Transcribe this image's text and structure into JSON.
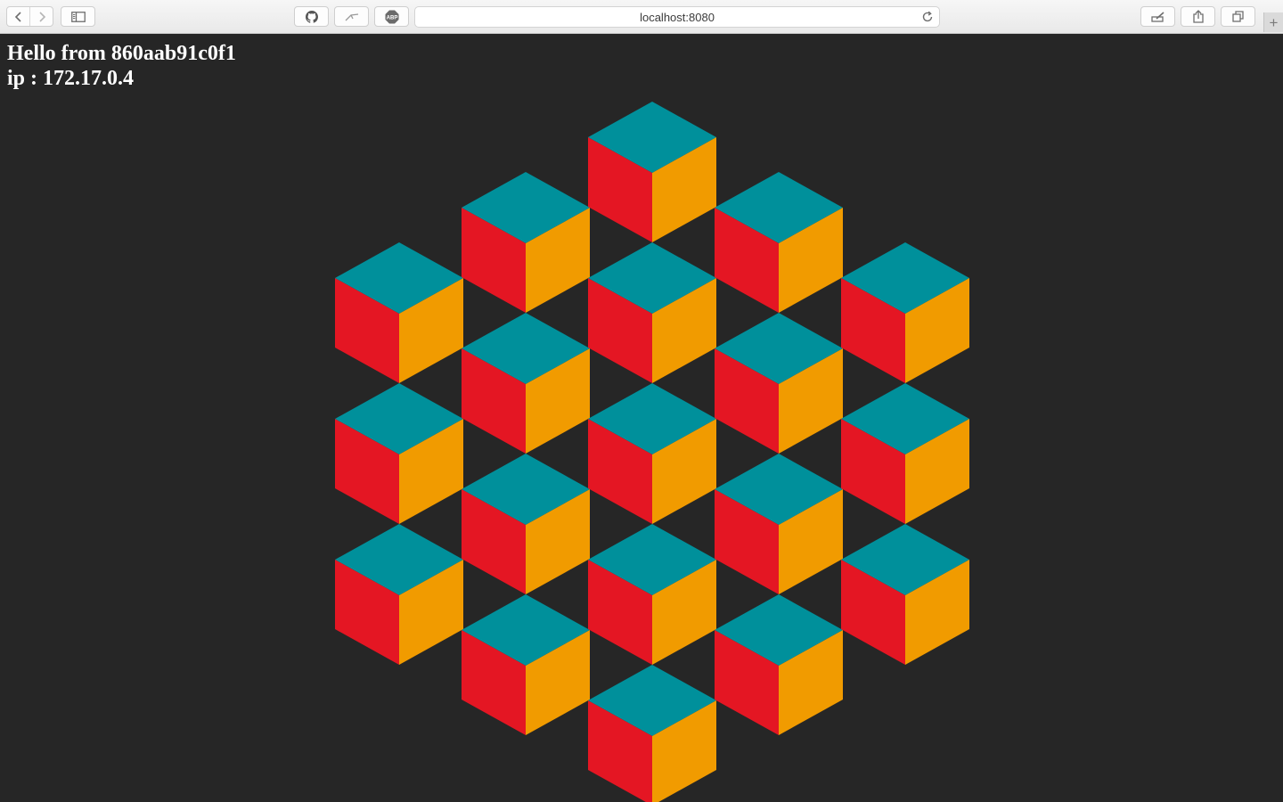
{
  "browser": {
    "url": "localhost:8080",
    "icons": {
      "back": "back-arrow-icon",
      "forward": "forward-arrow-icon",
      "sidebar": "sidebar-icon",
      "github": "github-icon",
      "extension": "extension-icon",
      "adblock": "adblock-icon",
      "reload": "reload-icon",
      "annotate": "annotate-icon",
      "share": "share-icon",
      "tabs": "tabs-icon",
      "new_tab": "new-tab-icon"
    },
    "adblock_label": "ABP",
    "new_tab_label": "+"
  },
  "page": {
    "hello": "Hello from 860aab91c0f1",
    "ip": "ip : 172.17.0.4",
    "background": "#262626",
    "text_color": "#ffffff",
    "cube_colors": {
      "top": "#00909b",
      "left": "#e41623",
      "right": "#f19b00"
    }
  }
}
